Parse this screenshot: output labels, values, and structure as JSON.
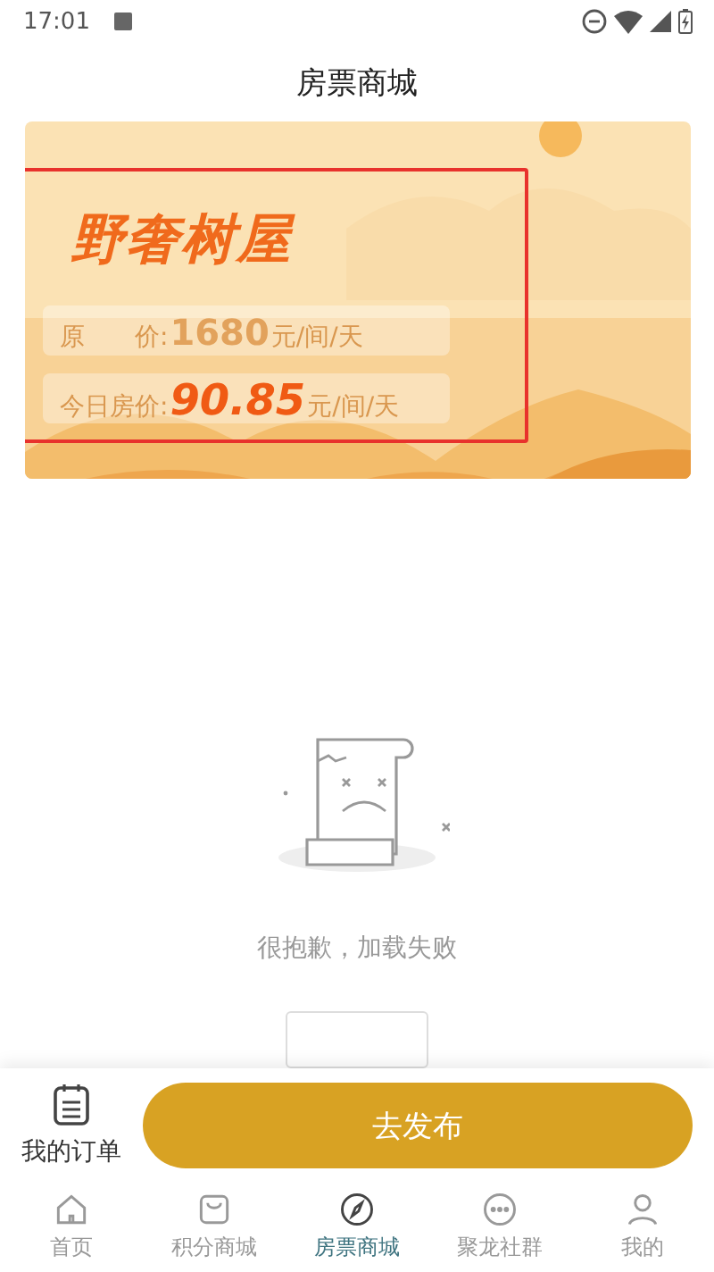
{
  "status_bar": {
    "time": "17:01"
  },
  "header": {
    "title": "房票商城"
  },
  "banner": {
    "kind": "picture",
    "name": "野奢树屋",
    "prices": [
      {
        "label": "原　　价:",
        "amount": "1680",
        "unit": "元/间/天",
        "kind": "original"
      },
      {
        "label": "今日房价:",
        "amount": "90.85",
        "unit": "元/间/天",
        "kind": "today"
      }
    ],
    "highlighted": true
  },
  "empty_state": {
    "message": "很抱歉，加载失败"
  },
  "action_bar": {
    "orders_label": "我的订单",
    "publish_button": "去发布"
  },
  "tab_bar": [
    {
      "label": "首页",
      "kind": "home",
      "selected": false
    },
    {
      "label": "积分商城",
      "kind": "bag",
      "selected": false
    },
    {
      "label": "房票商城",
      "kind": "compass",
      "selected": true
    },
    {
      "label": "聚龙社群",
      "kind": "chat",
      "selected": false
    },
    {
      "label": "我的",
      "kind": "user",
      "selected": false
    }
  ]
}
